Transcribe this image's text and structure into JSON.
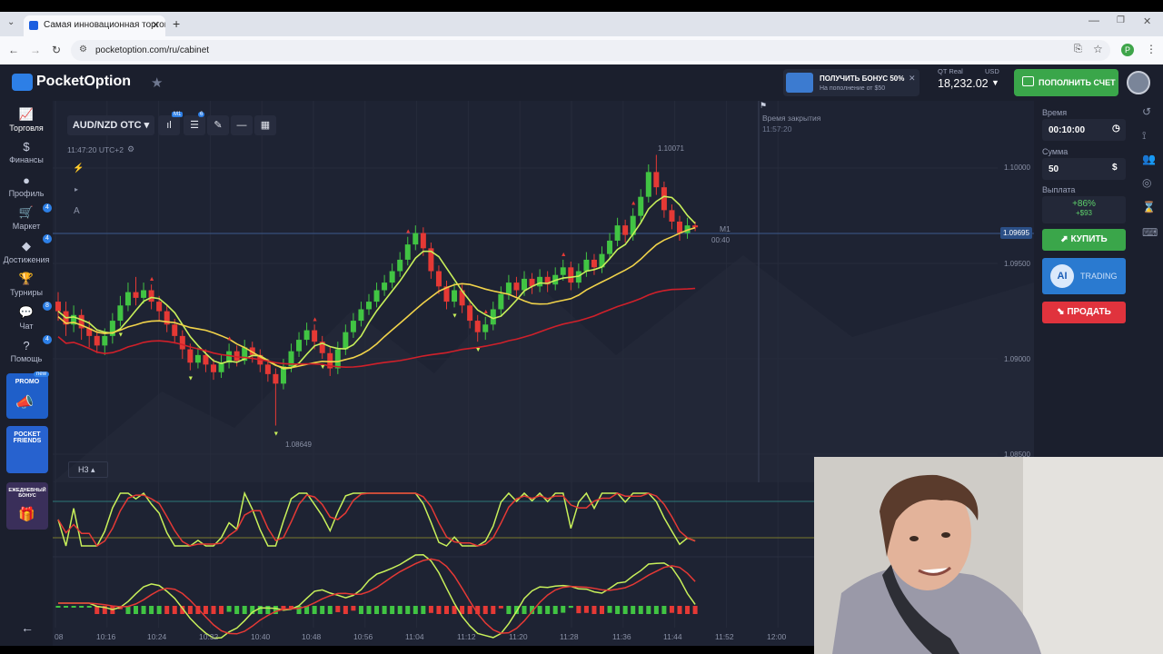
{
  "browser": {
    "tab_title": "Самая инновационная торгов",
    "tab_close": "✕",
    "new_tab": "+",
    "url": "pocketoption.com/ru/cabinet",
    "profile_initial": "P"
  },
  "header": {
    "logo_text": "PocketOption",
    "bonus_title": "ПОЛУЧИТЬ БОНУС 50%",
    "bonus_sub": "На пополнение от $50",
    "bonus_close": "✕",
    "account_type": "QT Real",
    "currency": "USD",
    "balance": "18,232.02",
    "deposit_label": "ПОПОЛНИТЬ СЧЕТ"
  },
  "sidebar": {
    "items": [
      {
        "label": "Торговля",
        "icon": "chart-icon"
      },
      {
        "label": "Финансы",
        "icon": "dollar-icon"
      },
      {
        "label": "Профиль",
        "icon": "user-icon"
      },
      {
        "label": "Маркет",
        "icon": "cart-icon"
      },
      {
        "label": "Достижения",
        "icon": "diamond-icon"
      },
      {
        "label": "Турниры",
        "icon": "trophy-icon"
      },
      {
        "label": "Чат",
        "icon": "chat-icon"
      },
      {
        "label": "Помощь",
        "icon": "help-icon"
      }
    ],
    "badges": [
      "4",
      "4",
      "8",
      "4"
    ],
    "promo_new": "new",
    "promo_label": "PROMO",
    "friends_label": "POCKET FRIENDS",
    "daily_bonus_label": "ЕЖЕДНЕВНЫЙ БОНУС",
    "back_arrow": "←"
  },
  "toolbar": {
    "pair": "AUD/NZD OTC",
    "timeframe_badge": "M1",
    "indicator_badge": "6",
    "server_time": "11:47:20 UTC+2",
    "tool_a": "A",
    "h3_label": "H3"
  },
  "chart_overlay": {
    "close_time_label": "Время закрытия",
    "close_time": "11:57:20",
    "timer_tf": "M1",
    "timer": "00:40",
    "current_price": "1.09695",
    "high_label": "1.10071",
    "low_label": "1.08649"
  },
  "chart_data": {
    "type": "candlestick",
    "price_axis": [
      "1.10000",
      "1.09500",
      "1.09000",
      "1.08500"
    ],
    "ylim": [
      1.085,
      1.1012
    ],
    "time_axis": [
      "08",
      "10:16",
      "10:24",
      "10:32",
      "10:40",
      "10:48",
      "10:56",
      "11:04",
      "11:12",
      "11:20",
      "11:28",
      "11:36",
      "11:44",
      "11:52",
      "12:00"
    ],
    "candles": [
      [
        1.093,
        1.0925,
        1.0935,
        1.092
      ],
      [
        1.0925,
        1.0918,
        1.093,
        1.0912
      ],
      [
        1.0918,
        1.0923,
        1.0928,
        1.0914
      ],
      [
        1.0923,
        1.0916,
        1.0926,
        1.091
      ],
      [
        1.0916,
        1.0912,
        1.092,
        1.0906
      ],
      [
        1.0912,
        1.0907,
        1.0915,
        1.0903
      ],
      [
        1.0907,
        1.0912,
        1.0916,
        1.0902
      ],
      [
        1.0912,
        1.092,
        1.0924,
        1.0908
      ],
      [
        1.092,
        1.0928,
        1.0933,
        1.0917
      ],
      [
        1.0928,
        1.0935,
        1.094,
        1.0925
      ],
      [
        1.0935,
        1.0932,
        1.0943,
        1.0928
      ],
      [
        1.0932,
        1.0936,
        1.094,
        1.0929
      ],
      [
        1.0936,
        1.093,
        1.0939,
        1.0926
      ],
      [
        1.093,
        1.0925,
        1.0933,
        1.092
      ],
      [
        1.0925,
        1.0918,
        1.0928,
        1.0914
      ],
      [
        1.0918,
        1.0912,
        1.0921,
        1.0908
      ],
      [
        1.0912,
        1.0905,
        1.0915,
        1.09
      ],
      [
        1.0905,
        1.0898,
        1.0908,
        1.0894
      ],
      [
        1.0898,
        1.0902,
        1.0906,
        1.0895
      ],
      [
        1.0902,
        1.0897,
        1.0905,
        1.0893
      ],
      [
        1.0897,
        1.0893,
        1.09,
        1.0889
      ],
      [
        1.0893,
        1.0898,
        1.0902,
        1.089
      ],
      [
        1.0898,
        1.0904,
        1.0908,
        1.0895
      ],
      [
        1.0904,
        1.0899,
        1.0907,
        1.0896
      ],
      [
        1.0899,
        1.0906,
        1.091,
        1.0897
      ],
      [
        1.0906,
        1.0902,
        1.0909,
        1.0898
      ],
      [
        1.0902,
        1.0897,
        1.0905,
        1.0893
      ],
      [
        1.0897,
        1.0892,
        1.09,
        1.0888
      ],
      [
        1.0892,
        1.0887,
        1.0895,
        1.0865
      ],
      [
        1.0887,
        1.0896,
        1.09,
        1.0884
      ],
      [
        1.0896,
        1.0904,
        1.0908,
        1.0893
      ],
      [
        1.0904,
        1.091,
        1.0914,
        1.0901
      ],
      [
        1.091,
        1.0915,
        1.0919,
        1.0907
      ],
      [
        1.0915,
        1.0909,
        1.0918,
        1.0905
      ],
      [
        1.0909,
        1.0903,
        1.0912,
        1.09
      ],
      [
        1.0903,
        1.0895,
        1.0906,
        1.0891
      ],
      [
        1.0895,
        1.0905,
        1.0909,
        1.0892
      ],
      [
        1.0905,
        1.0914,
        1.0918,
        1.0902
      ],
      [
        1.0914,
        1.092,
        1.0924,
        1.0911
      ],
      [
        1.092,
        1.0926,
        1.093,
        1.0917
      ],
      [
        1.0926,
        1.093,
        1.0934,
        1.0923
      ],
      [
        1.093,
        1.0936,
        1.094,
        1.0927
      ],
      [
        1.0936,
        1.094,
        1.0944,
        1.0933
      ],
      [
        1.094,
        1.0946,
        1.095,
        1.0937
      ],
      [
        1.0946,
        1.0952,
        1.0956,
        1.0943
      ],
      [
        1.0952,
        1.096,
        1.0964,
        1.0949
      ],
      [
        1.096,
        1.0966,
        1.097,
        1.0957
      ],
      [
        1.0966,
        1.0958,
        1.0969,
        1.0954
      ],
      [
        1.0958,
        1.0946,
        1.0961,
        1.0942
      ],
      [
        1.0946,
        1.0938,
        1.0949,
        1.0934
      ],
      [
        1.0938,
        1.093,
        1.0941,
        1.0926
      ],
      [
        1.093,
        1.0936,
        1.094,
        1.0927
      ],
      [
        1.0936,
        1.0928,
        1.0939,
        1.0924
      ],
      [
        1.0928,
        1.092,
        1.0931,
        1.0916
      ],
      [
        1.092,
        1.0914,
        1.0923,
        1.0909
      ],
      [
        1.0914,
        1.0918,
        1.0922,
        1.091
      ],
      [
        1.0918,
        1.0926,
        1.093,
        1.0915
      ],
      [
        1.0926,
        1.0934,
        1.0938,
        1.0923
      ],
      [
        1.0934,
        1.094,
        1.0944,
        1.0931
      ],
      [
        1.094,
        1.0936,
        1.0943,
        1.0932
      ],
      [
        1.0936,
        1.0942,
        1.0946,
        1.0933
      ],
      [
        1.0942,
        1.0938,
        1.0945,
        1.0934
      ],
      [
        1.0938,
        1.0943,
        1.0947,
        1.0935
      ],
      [
        1.0943,
        1.0939,
        1.0946,
        1.0935
      ],
      [
        1.0939,
        1.0944,
        1.0948,
        1.0936
      ],
      [
        1.0944,
        1.0948,
        1.0952,
        1.0941
      ],
      [
        1.0948,
        1.094,
        1.0951,
        1.0936
      ],
      [
        1.094,
        1.0946,
        1.095,
        1.0937
      ],
      [
        1.0946,
        1.0952,
        1.0956,
        1.0943
      ],
      [
        1.0952,
        1.0948,
        1.0955,
        1.0944
      ],
      [
        1.0948,
        1.0955,
        1.0959,
        1.0945
      ],
      [
        1.0955,
        1.0962,
        1.0966,
        1.0952
      ],
      [
        1.0962,
        1.097,
        1.0974,
        1.0959
      ],
      [
        1.097,
        1.0965,
        1.0973,
        1.0961
      ],
      [
        1.0965,
        1.0975,
        1.0979,
        1.0962
      ],
      [
        1.0975,
        1.0985,
        1.0989,
        1.0972
      ],
      [
        1.0985,
        1.0998,
        1.1002,
        1.0982
      ],
      [
        1.0998,
        1.099,
        1.1007,
        1.0986
      ],
      [
        1.099,
        1.0978,
        1.0993,
        1.0974
      ],
      [
        1.0978,
        1.0972,
        1.0981,
        1.0968
      ],
      [
        1.0972,
        1.0966,
        1.0975,
        1.0962
      ],
      [
        1.0966,
        1.097,
        1.0974,
        1.0963
      ],
      [
        1.097,
        1.0969,
        1.0972,
        1.0967
      ]
    ]
  },
  "right_panel": {
    "time_label": "Время",
    "time_value": "00:10:00",
    "amount_label": "Сумма",
    "amount_value": "50",
    "payout_label": "Выплата",
    "payout_pct": "+86%",
    "payout_amount": "+$93",
    "buy_label": "КУПИТЬ",
    "ai_label": "AI",
    "ai_trading": "TRADING",
    "sell_label": "ПРОДАТЬ"
  }
}
